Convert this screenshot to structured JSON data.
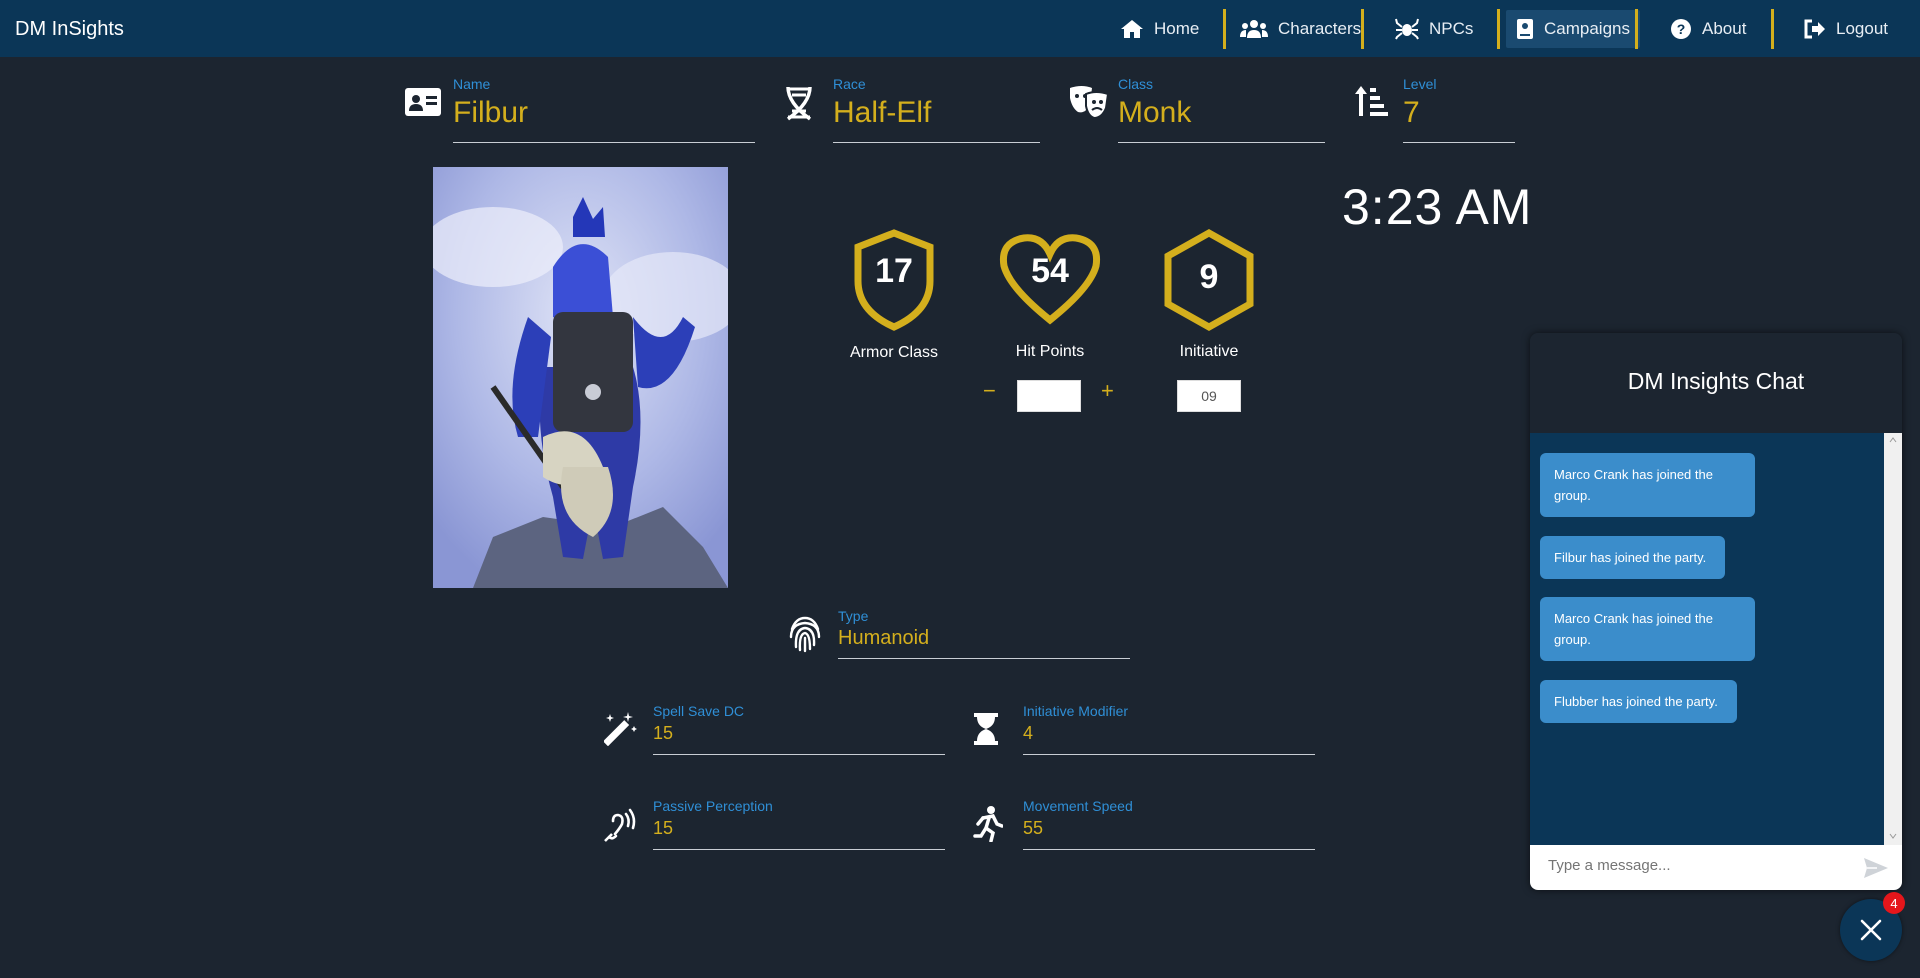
{
  "app": {
    "brand": "DM InSights"
  },
  "nav": {
    "items": [
      {
        "label": "Home",
        "icon": "home-icon"
      },
      {
        "label": "Characters",
        "icon": "users-icon"
      },
      {
        "label": "NPCs",
        "icon": "spider-icon"
      },
      {
        "label": "Campaigns",
        "icon": "book-icon",
        "active": true
      },
      {
        "label": "About",
        "icon": "question-circle-icon"
      },
      {
        "label": "Logout",
        "icon": "logout-icon"
      }
    ]
  },
  "character": {
    "name_label": "Name",
    "name": "Filbur",
    "race_label": "Race",
    "race": "Half-Elf",
    "class_label": "Class",
    "class": "Monk",
    "level_label": "Level",
    "level": "7",
    "type_label": "Type",
    "type": "Humanoid"
  },
  "clock": "3:23 AM",
  "stats": {
    "armor_class": {
      "value": "17",
      "label": "Armor Class"
    },
    "hit_points": {
      "value": "54",
      "label": "Hit Points",
      "minus": "−",
      "plus": "+",
      "input_value": ""
    },
    "initiative": {
      "value": "9",
      "label": "Initiative",
      "input_value": "09"
    }
  },
  "details": {
    "spell_save_dc": {
      "label": "Spell Save DC",
      "value": "15"
    },
    "initiative_modifier": {
      "label": "Initiative Modifier",
      "value": "4"
    },
    "passive_perception": {
      "label": "Passive Perception",
      "value": "15"
    },
    "movement_speed": {
      "label": "Movement Speed",
      "value": "55"
    }
  },
  "chat": {
    "title": "DM Insights Chat",
    "messages": [
      "Marco Crank has joined the group.",
      "Filbur has joined the party.",
      "Marco Crank has joined the group.",
      "Flubber has joined the party."
    ],
    "placeholder": "Type a message...",
    "badge_count": "4"
  },
  "colors": {
    "navbar": "#0b3657",
    "accent": "#d4af1d",
    "label_blue": "#2f8fd6",
    "background": "#1c2530"
  }
}
